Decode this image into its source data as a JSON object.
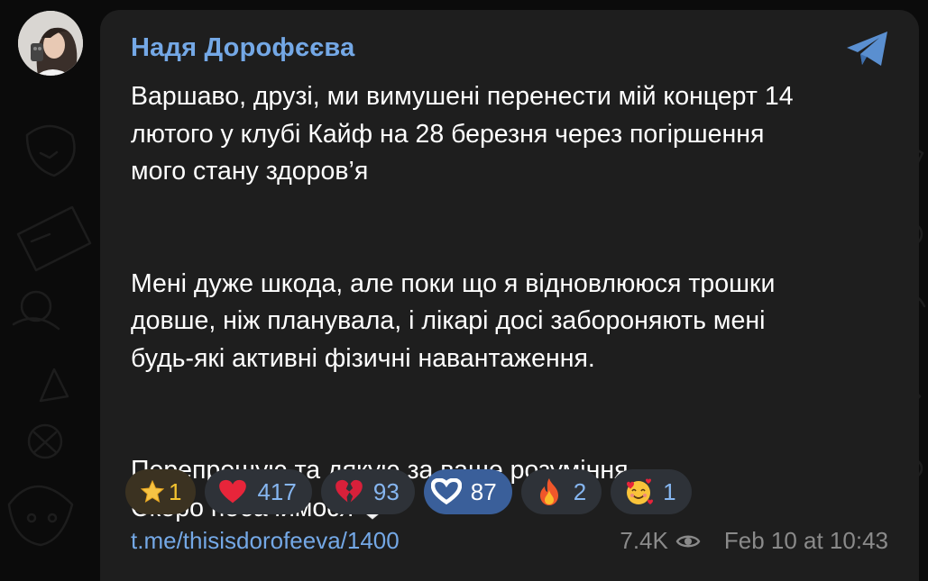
{
  "channel": {
    "sender_name": "Надя Дорофєєва",
    "avatar_icon": "profile-photo",
    "logo_icon": "telegram-icon"
  },
  "message": {
    "paragraph1_line1": "Варшаво, друзі, ми вимушені перенести мій концерт 14",
    "paragraph1_line2": "лютого у клубі Кайф на 28 березня через погіршення",
    "paragraph1_line3": "мого стану здоров’я",
    "paragraph2_line1": "Мені дуже шкода, але поки що я відновлююся трошки",
    "paragraph2_line2": "довше, ніж планувала, і лікарі досі забороняють мені",
    "paragraph2_line3": "будь-які активні фізичні навантаження.",
    "paragraph3_line1": "Перепрошую та дякую за ваше розуміння.",
    "paragraph3_line2": "Скоро побачимося",
    "trailing_emoji": "white-heart-icon"
  },
  "reactions": [
    {
      "icon": "star-icon",
      "count": "1"
    },
    {
      "icon": "red-heart-icon",
      "count": "417"
    },
    {
      "icon": "broken-heart-icon",
      "count": "93"
    },
    {
      "icon": "heart-hands-icon",
      "count": "87"
    },
    {
      "icon": "fire-icon",
      "count": "2"
    },
    {
      "icon": "smiling-face-with-hearts-icon",
      "count": "1"
    }
  ],
  "footer": {
    "link": "t.me/thisisdorofeeva/1400",
    "views": "7.4K",
    "views_icon": "eye-icon",
    "timestamp": "Feb 10 at 10:43"
  },
  "colors": {
    "background": "#0b0b0b",
    "bubble": "#1e1e1e",
    "accent": "#74a8e6",
    "reaction_bg": "#2e3238",
    "paid_reaction_bg": "#3b3221",
    "muted": "#8a8a8a"
  }
}
